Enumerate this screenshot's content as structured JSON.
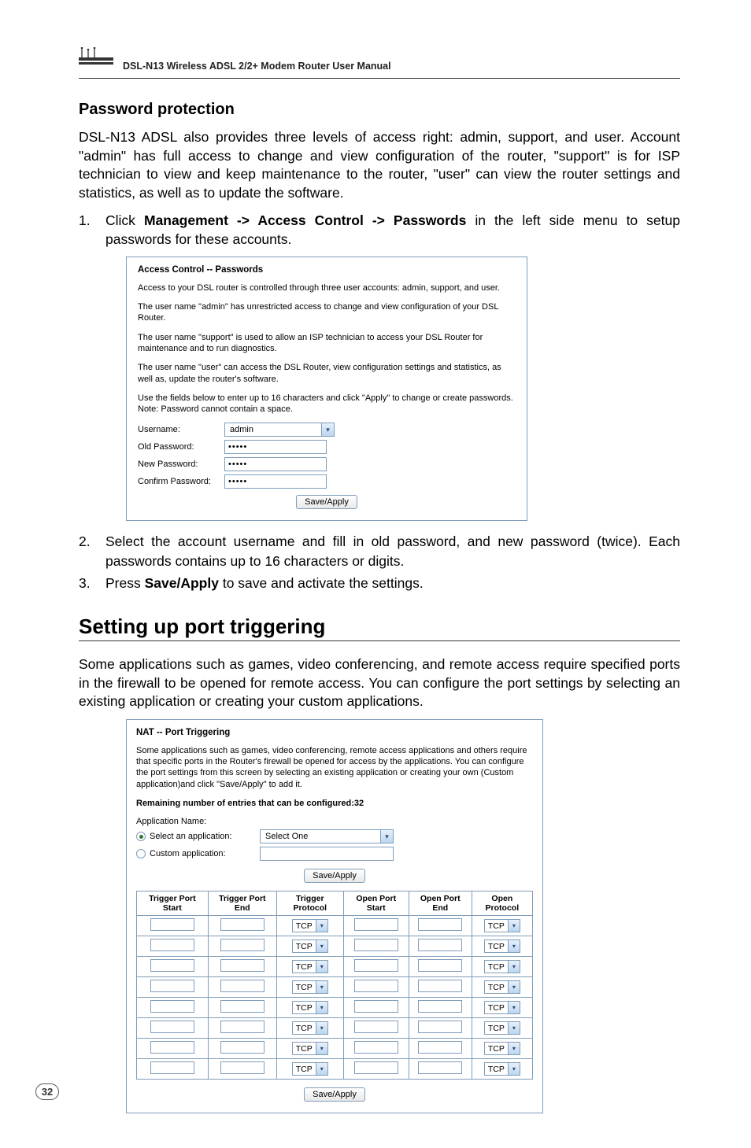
{
  "header": {
    "manual_title": "DSL-N13 Wireless ADSL 2/2+ Modem Router User Manual"
  },
  "section1": {
    "title": "Password protection",
    "intro": "DSL-N13 ADSL also provides three levels of access right: admin, support, and user. Account \"admin\" has full access to change and view configuration of the router, \"support\" is for ISP technician to view and keep maintenance to the router, \"user\" can view the router settings and statistics, as well as to update the software.",
    "step1_pre": "Click ",
    "step1_bold": "Management -> Access Control -> Passwords",
    "step1_post": " in the left side menu to setup passwords for these accounts.",
    "step2": "Select the account username and fill in old password, and new password (twice). Each passwords contains up to 16 characters or digits.",
    "step3_pre": "Press ",
    "step3_bold": "Save/Apply",
    "step3_post": " to save and activate the settings."
  },
  "shot1": {
    "heading": "Access Control -- Passwords",
    "p1": "Access to your DSL router is controlled through three user accounts: admin, support, and user.",
    "p2": "The user name \"admin\" has unrestricted access to change and view configuration of your DSL Router.",
    "p3": "The user name \"support\" is used to allow an ISP technician to access your DSL Router for maintenance and to run diagnostics.",
    "p4": "The user name \"user\" can access the DSL Router, view configuration settings and statistics, as well as, update the router's software.",
    "p5": "Use the fields below to enter up to 16 characters and click \"Apply\" to change or create passwords. Note: Password cannot contain a space.",
    "labels": {
      "username": "Username:",
      "old": "Old Password:",
      "new": "New Password:",
      "confirm": "Confirm Password:"
    },
    "values": {
      "username": "admin",
      "old": "•••••",
      "new": "•••••",
      "confirm": "•••••"
    },
    "button": "Save/Apply"
  },
  "section2": {
    "title": "Setting up port triggering",
    "intro": "Some applications such as games, video conferencing, and remote access require specified ports in the firewall to be opened for remote access. You can configure the port settings by selecting an existing application or creating your custom applications."
  },
  "shot2": {
    "heading": "NAT -- Port Triggering",
    "p1": "Some applications such as games, video conferencing, remote access applications and others require that specific ports in the Router's firewall be opened for access by the applications. You can configure the port settings from this screen by selecting an existing application or creating your own (Custom application)and click \"Save/Apply\" to add it.",
    "remaining": "Remaining number of entries that can be configured:32",
    "appname_label": "Application Name:",
    "radio1": "Select an application:",
    "radio2": "Custom application:",
    "select_val": "Select One",
    "button": "Save/Apply",
    "th": {
      "c1": "Trigger Port Start",
      "c2": "Trigger Port End",
      "c3": "Trigger Protocol",
      "c4": "Open Port Start",
      "c5": "Open Port End",
      "c6": "Open Protocol"
    },
    "tcp": "TCP"
  },
  "footer": {
    "page": "32"
  }
}
